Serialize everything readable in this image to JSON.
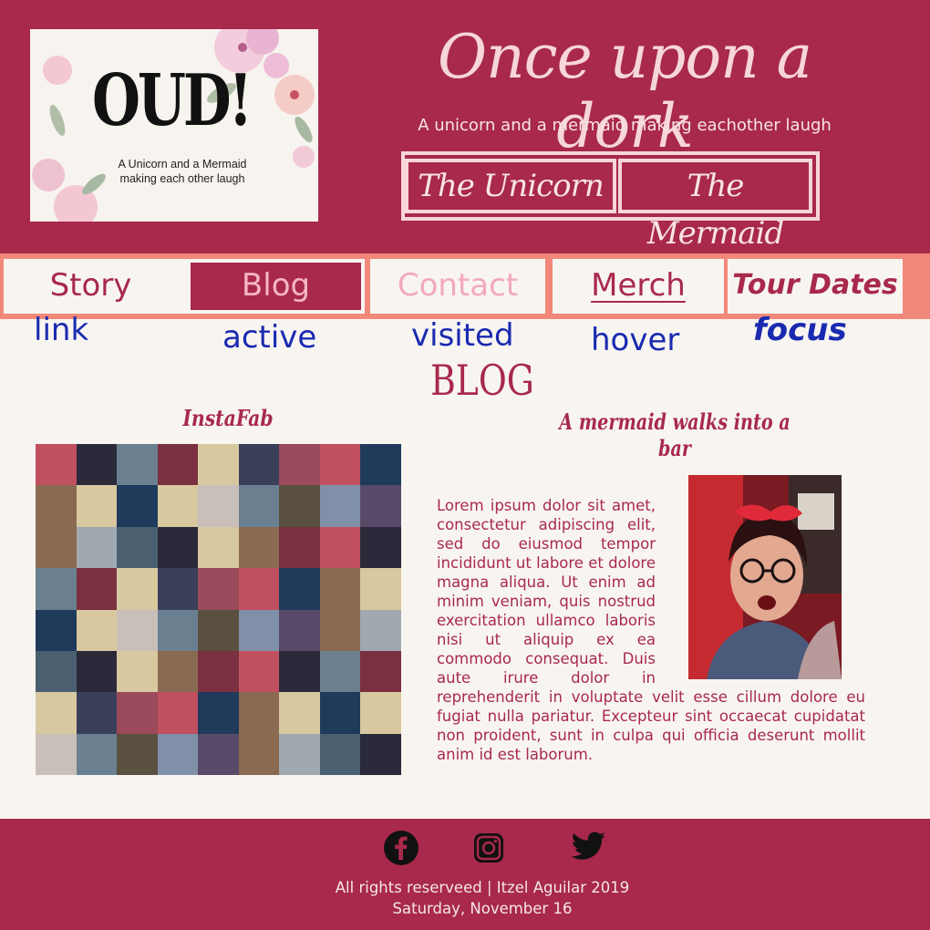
{
  "header": {
    "logo": {
      "title": "OUD!",
      "subtitle": "A Unicorn and a Mermaid making each other laugh"
    },
    "site_title": "Once upon a dork",
    "tagline": "A unicorn and a mermaid making eachother laugh",
    "character_links": [
      {
        "label": "The Unicorn"
      },
      {
        "label": "The Mermaid"
      }
    ]
  },
  "nav": {
    "items": [
      {
        "label": "Story"
      },
      {
        "label": "Blog"
      },
      {
        "label": "Contact"
      },
      {
        "label": "Merch"
      },
      {
        "label": "Tour Dates"
      }
    ],
    "state_labels": [
      "link",
      "active",
      "visited",
      "hover",
      "focus"
    ]
  },
  "main": {
    "heading": "BLOG",
    "instafab_title": "InstaFab",
    "post_title": "A mermaid walks into a bar",
    "post_body": "Lorem ipsum dolor sit amet, consectetur adipiscing elit, sed do eiusmod tempor incididunt ut labore et dolore magna aliqua. Ut enim ad minim veniam, quis nostrud exercitation ullamco laboris nisi ut aliquip ex ea commodo consequat. Duis aute irure dolor in reprehenderit in voluptate velit esse cillum dolore eu fugiat nulla pariatur. Excepteur sint occaecat cupidatat non proident, sunt in culpa qui officia deserunt mollit anim id est laborum."
  },
  "footer": {
    "social": [
      "facebook-icon",
      "instagram-icon",
      "twitter-icon"
    ],
    "copyright": "All rights reserveed |  Itzel Aguilar 2019",
    "date": "Saturday, November 16"
  },
  "colors": {
    "primary": "#a8294c",
    "nav_band": "#f2887a",
    "background": "#f8f5f1",
    "state_label": "#1a2ab0"
  }
}
